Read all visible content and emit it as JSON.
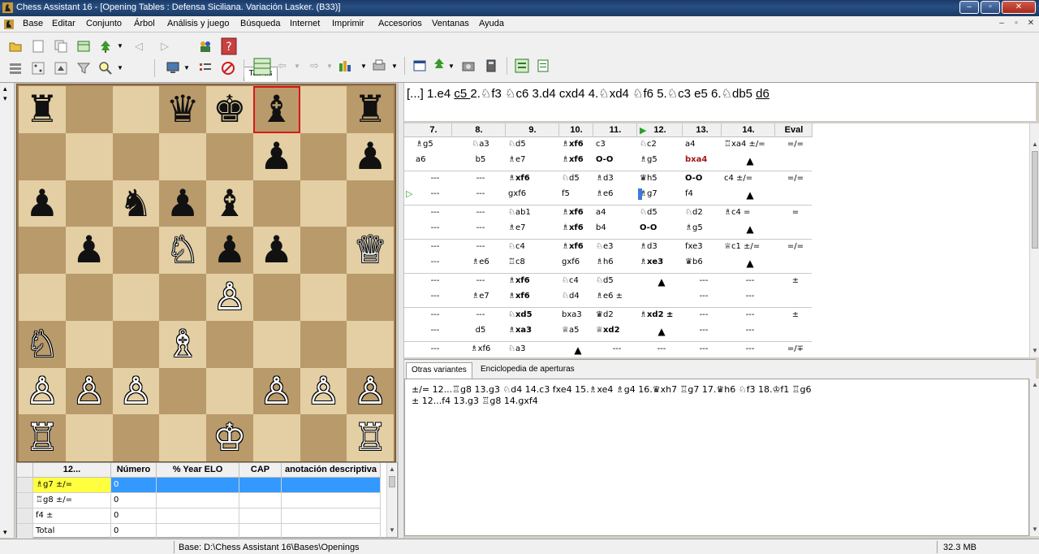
{
  "window": {
    "title": "Chess Assistant 16 - [Opening Tables  : Defensa Siciliana. Variación Lasker. (B33)]",
    "min": "–",
    "max": "▫",
    "close": "✕"
  },
  "menu": [
    "Base",
    "Editar",
    "Conjunto",
    "Árbol",
    "Análisis y juego",
    "Búsqueda",
    "Internet",
    "Imprimir",
    "Accesorios",
    "Ventanas",
    "Ayuda"
  ],
  "mdi_controls": [
    "–",
    "▫",
    "✕"
  ],
  "toolbar_tab": "Tablas",
  "board": {
    "squares_light": "#e3cfa3",
    "squares_dark": "#b99a6b",
    "selection_color": "#d81818",
    "pieces": [
      {
        "sq": "a8",
        "glyph": "♜",
        "color": "black"
      },
      {
        "sq": "d8",
        "glyph": "♛",
        "color": "black"
      },
      {
        "sq": "e8",
        "glyph": "♚",
        "color": "black"
      },
      {
        "sq": "f8",
        "glyph": "♝",
        "color": "black"
      },
      {
        "sq": "h8",
        "glyph": "♜",
        "color": "black"
      },
      {
        "sq": "f7",
        "glyph": "♟",
        "color": "black"
      },
      {
        "sq": "h7",
        "glyph": "♟",
        "color": "black"
      },
      {
        "sq": "a6",
        "glyph": "♟",
        "color": "black"
      },
      {
        "sq": "c6",
        "glyph": "♞",
        "color": "black"
      },
      {
        "sq": "d6",
        "glyph": "♟",
        "color": "black"
      },
      {
        "sq": "e6",
        "glyph": "♝",
        "color": "black"
      },
      {
        "sq": "b5",
        "glyph": "♟",
        "color": "black"
      },
      {
        "sq": "d5",
        "glyph": "♘",
        "color": "white"
      },
      {
        "sq": "e5",
        "glyph": "♟",
        "color": "black"
      },
      {
        "sq": "f5",
        "glyph": "♟",
        "color": "black"
      },
      {
        "sq": "h5",
        "glyph": "♕",
        "color": "white"
      },
      {
        "sq": "e4",
        "glyph": "♙",
        "color": "white"
      },
      {
        "sq": "a3",
        "glyph": "♘",
        "color": "white"
      },
      {
        "sq": "d3",
        "glyph": "♗",
        "color": "white"
      },
      {
        "sq": "a2",
        "glyph": "♙",
        "color": "white"
      },
      {
        "sq": "b2",
        "glyph": "♙",
        "color": "white"
      },
      {
        "sq": "c2",
        "glyph": "♙",
        "color": "white"
      },
      {
        "sq": "f2",
        "glyph": "♙",
        "color": "white"
      },
      {
        "sq": "g2",
        "glyph": "♙",
        "color": "white"
      },
      {
        "sq": "h2",
        "glyph": "♙",
        "color": "white"
      },
      {
        "sq": "a1",
        "glyph": "♖",
        "color": "white"
      },
      {
        "sq": "e1",
        "glyph": "♔",
        "color": "white"
      },
      {
        "sq": "h1",
        "glyph": "♖",
        "color": "white"
      }
    ],
    "selected": "f8"
  },
  "notation": "[...] 1.e4 c5 2.♘f3 ♘c6 3.d4 cxd4 4.♘xd4 ♘f6 5.♘c3 e5 6.♘db5 d6",
  "table": {
    "headers": [
      "7.",
      "8.",
      "9.",
      "10.",
      "11.",
      "12.",
      "13.",
      "14.",
      "Eval"
    ],
    "rows": [
      {
        "w": [
          "♗g5",
          "♘a3",
          "♘d5",
          "♗xf6",
          "c3",
          "♘c2",
          "a4",
          "♖xa4 ±/=",
          "=/="
        ],
        "b": [
          "a6",
          "b5",
          "♗e7",
          "♗xf6",
          "O-O",
          "♗g5",
          "bxa4",
          "▲",
          ""
        ]
      },
      {
        "w": [
          "---",
          "---",
          "♗xf6",
          "♘d5",
          "♗d3",
          "♛h5",
          "O-O",
          "c4 ±/=",
          "=/="
        ],
        "b": [
          "---",
          "---",
          "gxf6",
          "f5",
          "♗e6",
          "♗g7",
          "f4",
          "▲",
          ""
        ]
      },
      {
        "w": [
          "---",
          "---",
          "♘ab1",
          "♗xf6",
          "a4",
          "♘d5",
          "♘d2",
          "♗c4 =",
          "="
        ],
        "b": [
          "---",
          "---",
          "♗e7",
          "♗xf6",
          "b4",
          "O-O",
          "♗g5",
          "▲",
          ""
        ]
      },
      {
        "w": [
          "---",
          "---",
          "♘c4",
          "♗xf6",
          "♘e3",
          "♗d3",
          "fxe3",
          "♕c1 ±/=",
          "=/="
        ],
        "b": [
          "---",
          "♗e6",
          "♖c8",
          "gxf6",
          "♗h6",
          "♗xe3",
          "♛b6",
          "▲",
          ""
        ]
      },
      {
        "w": [
          "---",
          "---",
          "♗xf6",
          "♘c4",
          "♘d5",
          "▲",
          "---",
          "---",
          "±"
        ],
        "b": [
          "---",
          "♗e7",
          "♗xf6",
          "♘d4",
          "♗e6 ±",
          "",
          "---",
          "---",
          ""
        ]
      },
      {
        "w": [
          "---",
          "---",
          "♘xd5",
          "bxa3",
          "♛d2",
          "♗xd2 ±",
          "---",
          "---",
          "±"
        ],
        "b": [
          "---",
          "d5",
          "♗xa3",
          "♕a5",
          "♕xd2",
          "▲",
          "---",
          "---",
          ""
        ]
      },
      {
        "w": [
          "---",
          "♗xf6",
          "♘a3",
          "▲",
          "---",
          "---",
          "---",
          "---",
          "=/∓"
        ],
        "b": [
          "",
          "",
          "",
          "",
          "",
          "",
          "",
          "",
          ""
        ]
      }
    ]
  },
  "bottom_tabs": [
    "Otras variantes",
    "Enciclopedia de aperturas"
  ],
  "variants": [
    "±/= 12...♖g8 13.g3 ♘d4 14.c3 fxe4 15.♗xe4 ♗g4 16.♛xh7 ♖g7 17.♛h6 ♘f3 18.♔f1 ♖g6",
    "± 12...f4 13.g3 ♖g8 14.gxf4"
  ],
  "lower_grid": {
    "headers": [
      "12...",
      "Número",
      "%  Year  ELO",
      "CAP",
      "anotación descriptiva"
    ],
    "rows": [
      {
        "move": "♗g7 ±/=",
        "num": "0"
      },
      {
        "move": "♖g8 ±/=",
        "num": "0"
      },
      {
        "move": "f4 ±",
        "num": "0"
      },
      {
        "move": "Total",
        "num": "0"
      }
    ]
  },
  "status": {
    "base": "Base: D:\\Chess Assistant 16\\Bases\\Openings",
    "memory": "32.3 MB"
  }
}
